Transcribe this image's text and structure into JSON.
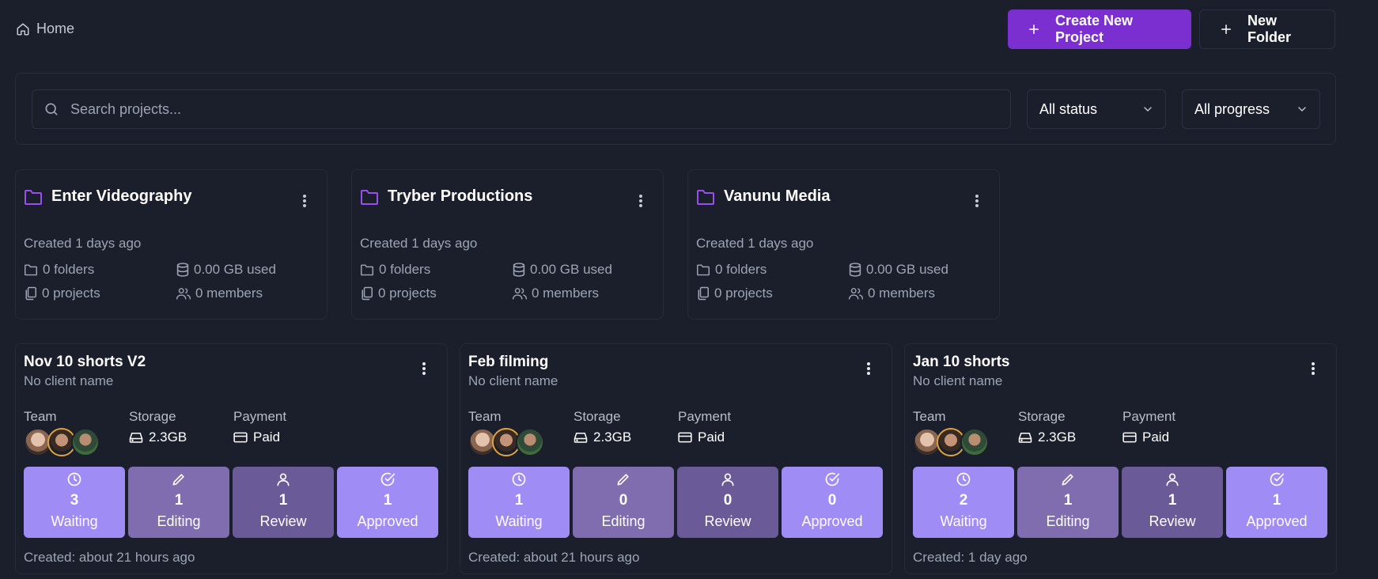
{
  "breadcrumb": {
    "home_label": "Home"
  },
  "actions": {
    "create_project": "Create New Project",
    "new_folder": "New Folder"
  },
  "search": {
    "placeholder": "Search projects...",
    "value": ""
  },
  "filters": {
    "status": "All status",
    "progress": "All progress"
  },
  "colors": {
    "accent": "#7c2fd1",
    "folder_icon": "#9b4ef0",
    "tile_waiting": "#9f8cf5",
    "tile_editing": "#7f6db0",
    "tile_review": "#6b5a98",
    "tile_approved": "#9f8cf5"
  },
  "folders": [
    {
      "name": "Enter Videography",
      "created": "Created 1 days ago",
      "folders": "0 folders",
      "storage": "0.00 GB used",
      "projects": "0 projects",
      "members": "0 members"
    },
    {
      "name": "Tryber Productions",
      "created": "Created 1 days ago",
      "folders": "0 folders",
      "storage": "0.00 GB used",
      "projects": "0 projects",
      "members": "0 members"
    },
    {
      "name": "Vanunu Media",
      "created": "Created 1 days ago",
      "folders": "0 folders",
      "storage": "0.00 GB used",
      "projects": "0 projects",
      "members": "0 members"
    }
  ],
  "labels": {
    "team": "Team",
    "storage": "Storage",
    "payment": "Payment"
  },
  "projects": [
    {
      "title": "Nov 10 shorts V2",
      "client": "No client name",
      "storage": "2.3GB",
      "payment": "Paid",
      "tiles": [
        {
          "count": "3",
          "label": "Waiting"
        },
        {
          "count": "1",
          "label": "Editing"
        },
        {
          "count": "1",
          "label": "Review"
        },
        {
          "count": "1",
          "label": "Approved"
        }
      ],
      "created": "Created: about 21 hours ago"
    },
    {
      "title": "Feb filming",
      "client": "No client name",
      "storage": "2.3GB",
      "payment": "Paid",
      "tiles": [
        {
          "count": "1",
          "label": "Waiting"
        },
        {
          "count": "0",
          "label": "Editing"
        },
        {
          "count": "0",
          "label": "Review"
        },
        {
          "count": "0",
          "label": "Approved"
        }
      ],
      "created": "Created: about 21 hours ago"
    },
    {
      "title": "Jan 10 shorts",
      "client": "No client name",
      "storage": "2.3GB",
      "payment": "Paid",
      "tiles": [
        {
          "count": "2",
          "label": "Waiting"
        },
        {
          "count": "1",
          "label": "Editing"
        },
        {
          "count": "1",
          "label": "Review"
        },
        {
          "count": "1",
          "label": "Approved"
        }
      ],
      "created": "Created: 1 day ago"
    }
  ]
}
